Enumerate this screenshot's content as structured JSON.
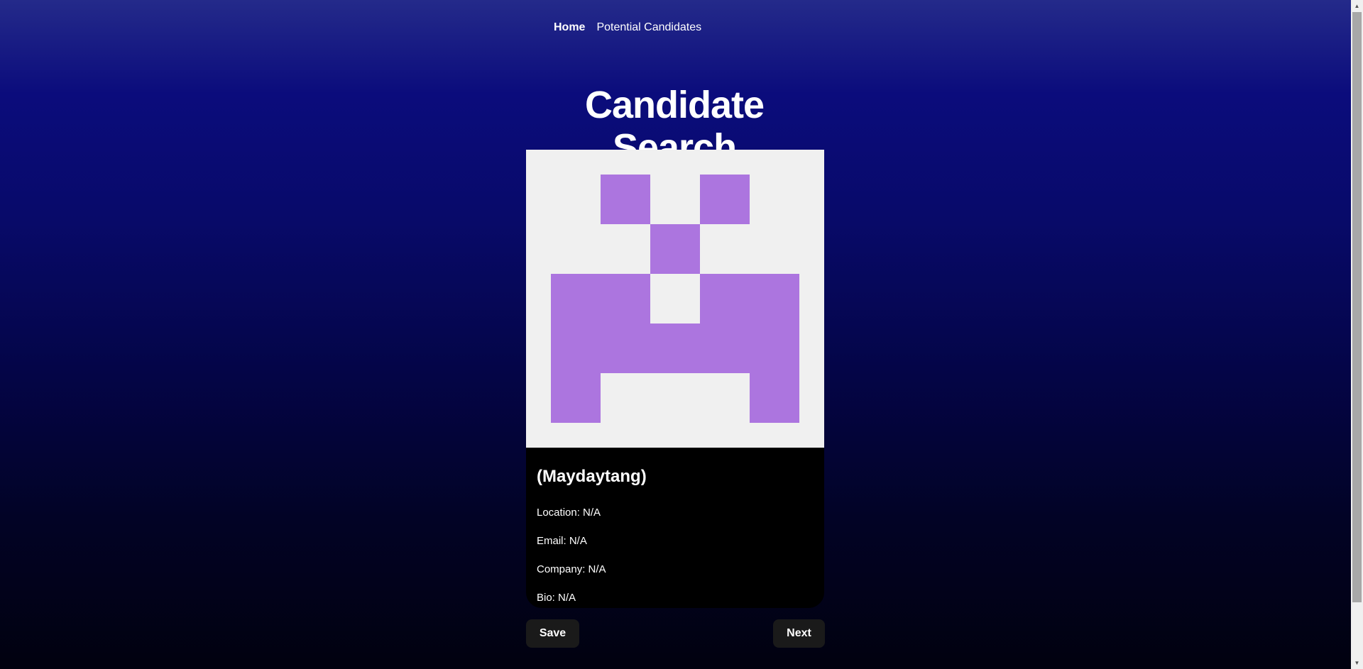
{
  "nav": {
    "home_label": "Home",
    "candidates_label": "Potential Candidates"
  },
  "page": {
    "title": "Candidate Search"
  },
  "candidate": {
    "avatar_color": "#ac75df",
    "avatar_background": "#f0f0f0",
    "name": "(Maydaytang)",
    "location": "Location: N/A",
    "email": "Email: N/A",
    "company": "Company: N/A",
    "bio": "Bio: N/A"
  },
  "actions": {
    "save_label": "Save",
    "next_label": "Next"
  },
  "scrollbar": {
    "up_arrow": "▲",
    "down_arrow": "▼"
  }
}
